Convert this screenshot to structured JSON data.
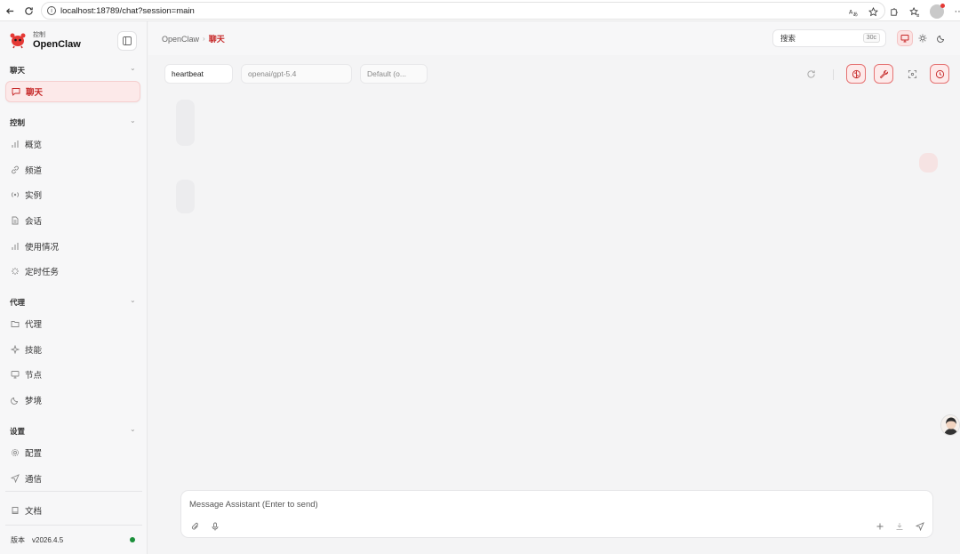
{
  "browser": {
    "url": "localhost:18789/chat?session=main",
    "icons": [
      "back-icon",
      "reload-icon",
      "info-icon",
      "translate-icon",
      "star-icon",
      "extensions-icon",
      "favorites-icon",
      "profile-icon",
      "more-icon"
    ]
  },
  "brand": {
    "subtitle": "控制",
    "name": "OpenClaw"
  },
  "sidebar": {
    "sections": [
      {
        "title": "聊天",
        "items": [
          {
            "label": "聊天",
            "icon": "chat-bubble-icon",
            "active": true
          }
        ]
      },
      {
        "title": "控制",
        "items": [
          {
            "label": "概览",
            "icon": "bar-chart-icon"
          },
          {
            "label": "频道",
            "icon": "link-icon"
          },
          {
            "label": "实例",
            "icon": "radio-icon"
          },
          {
            "label": "会话",
            "icon": "document-icon"
          },
          {
            "label": "使用情况",
            "icon": "bar-chart-icon"
          },
          {
            "label": "定时任务",
            "icon": "loader-icon"
          }
        ]
      },
      {
        "title": "代理",
        "items": [
          {
            "label": "代理",
            "icon": "folder-icon"
          },
          {
            "label": "技能",
            "icon": "sparkle-icon"
          },
          {
            "label": "节点",
            "icon": "monitor-icon"
          },
          {
            "label": "梦境",
            "icon": "moon-icon"
          }
        ]
      },
      {
        "title": "设置",
        "items": [
          {
            "label": "配置",
            "icon": "gear-icon"
          },
          {
            "label": "通信",
            "icon": "send-icon"
          }
        ]
      }
    ],
    "docs": {
      "label": "文档",
      "icon": "book-icon"
    },
    "version": {
      "label": "版本",
      "value": "v2026.4.5",
      "status_color": "#1b8f3a"
    }
  },
  "header": {
    "breadcrumb_root": "OpenClaw",
    "breadcrumb_current": "聊天",
    "search_label": "搜索",
    "search_shortcut": "30c"
  },
  "toolbar": {
    "session": "heartbeat",
    "model": "openai/gpt-5.4",
    "thinking": "Default (o..."
  },
  "composer": {
    "placeholder": "Message Assistant (Enter to send)"
  },
  "colors": {
    "accent": "#c62828",
    "accent_bg": "#fce9e9",
    "online": "#1b8f3a"
  }
}
